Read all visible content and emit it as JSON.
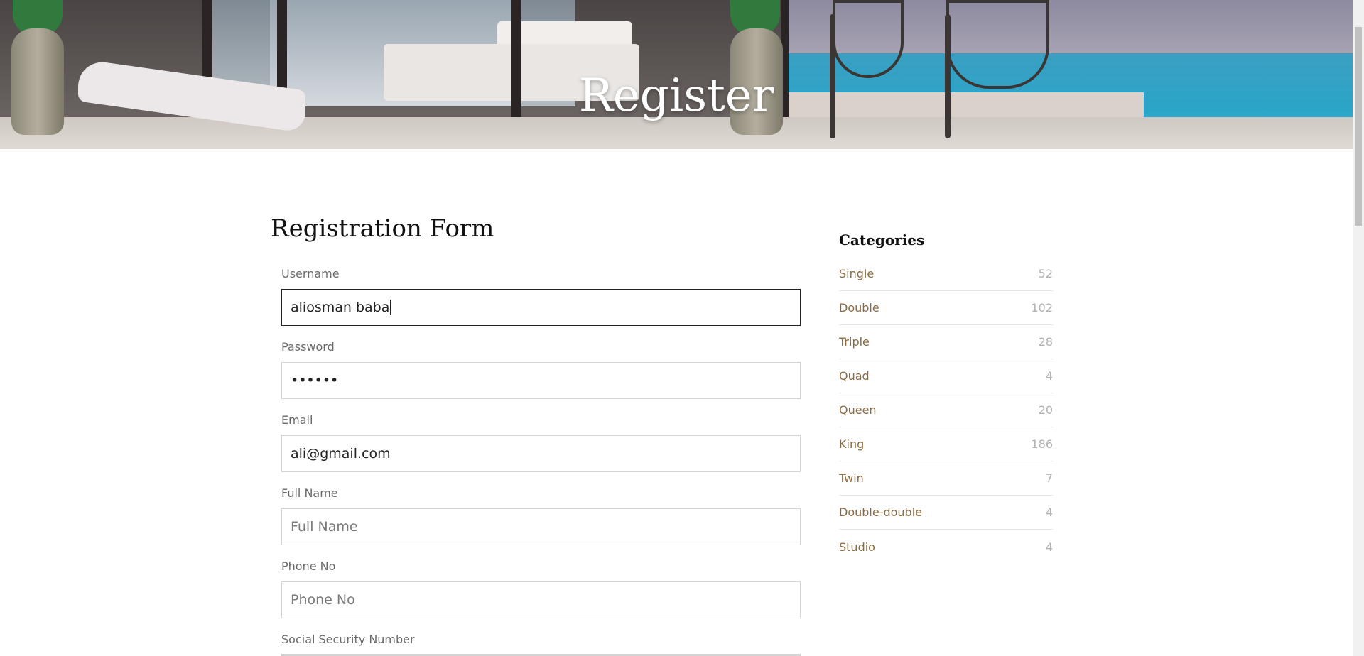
{
  "hero": {
    "title": "Register"
  },
  "form": {
    "title": "Registration Form",
    "fields": [
      {
        "label": "Username",
        "value": "aliosman baba",
        "placeholder": ""
      },
      {
        "label": "Password",
        "value": "••••••",
        "placeholder": ""
      },
      {
        "label": "Email",
        "value": "ali@gmail.com",
        "placeholder": ""
      },
      {
        "label": "Full Name",
        "value": "",
        "placeholder": "Full Name"
      },
      {
        "label": "Phone No",
        "value": "",
        "placeholder": "Phone No"
      },
      {
        "label": "Social Security Number",
        "value": "",
        "placeholder": ""
      }
    ]
  },
  "sidebar": {
    "title": "Categories",
    "items": [
      {
        "name": "Single",
        "count": "52"
      },
      {
        "name": "Double",
        "count": "102"
      },
      {
        "name": "Triple",
        "count": "28"
      },
      {
        "name": "Quad",
        "count": "4"
      },
      {
        "name": "Queen",
        "count": "20"
      },
      {
        "name": "King",
        "count": "186"
      },
      {
        "name": "Twin",
        "count": "7"
      },
      {
        "name": "Double-double",
        "count": "4"
      },
      {
        "name": "Studio",
        "count": "4"
      }
    ]
  },
  "colors": {
    "accent": "#8b6a3e",
    "count": "#b3b3b3"
  }
}
